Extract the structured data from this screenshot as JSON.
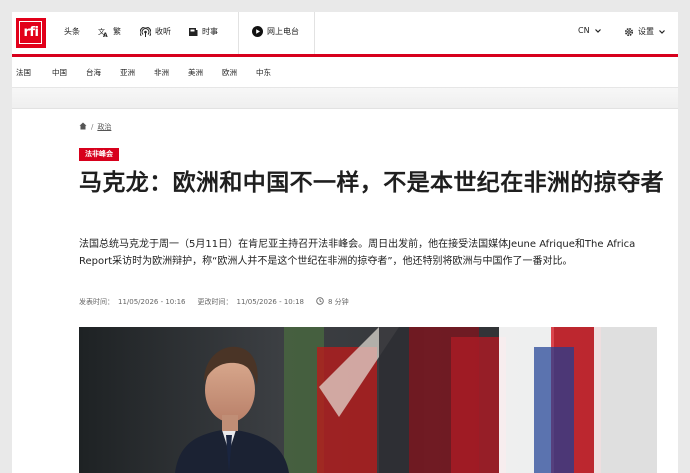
{
  "logo": {
    "text": "rfi"
  },
  "topnav": {
    "headlines": "头条",
    "lang_toggle": "繁",
    "listen": "收听",
    "news": "时事",
    "live_radio": "网上电台",
    "edition": "CN",
    "settings": "设置"
  },
  "regions": [
    "法国",
    "中国",
    "台海",
    "亚洲",
    "非洲",
    "美洲",
    "欧洲",
    "中东"
  ],
  "breadcrumb": {
    "section": "政治"
  },
  "article": {
    "tag": "法非峰会",
    "title": "马克龙：欧洲和中国不一样，不是本世纪在非洲的掠夺者",
    "lead": "法国总统马克龙于周一（5月11日）在肯尼亚主持召开法非峰会。周日出发前，他在接受法国媒体Jeune Afrique和The Africa Report采访时为欧洲辩护，称“欧洲人并不是这个世纪在非洲的掠夺者”，他还特别将欧洲与中国作了一番对比。",
    "published_label": "发表时间：",
    "published": "11/05/2026 - 10:16",
    "updated_label": "更改时间：",
    "updated": "11/05/2026 - 10:18",
    "read_time": "8 分钟"
  },
  "colors": {
    "brand_red": "#d7001c"
  }
}
